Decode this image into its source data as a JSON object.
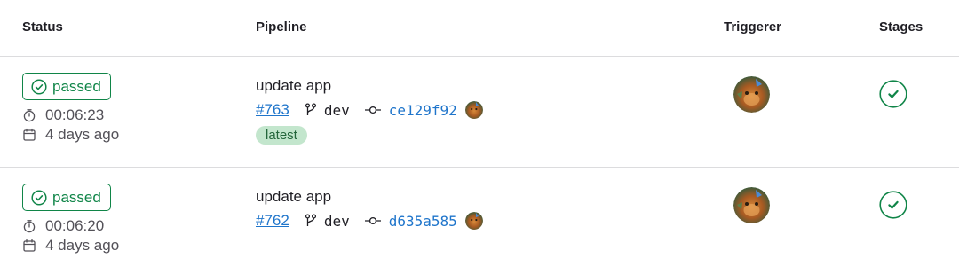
{
  "table": {
    "headers": {
      "status": "Status",
      "pipeline": "Pipeline",
      "triggerer": "Triggerer",
      "stages": "Stages"
    },
    "rows": [
      {
        "status": "passed",
        "duration": "00:06:23",
        "date": "4 days ago",
        "title": "update app",
        "pipeline_id": "#763",
        "branch": "dev",
        "commit": "ce129f92",
        "tag": "latest",
        "stage_status": "success"
      },
      {
        "status": "passed",
        "duration": "00:06:20",
        "date": "4 days ago",
        "title": "update app",
        "pipeline_id": "#762",
        "branch": "dev",
        "commit": "d635a585",
        "stage_status": "success"
      }
    ]
  },
  "icons": {
    "status": "check-circle-icon",
    "duration": "timer-icon",
    "date": "calendar-icon",
    "branch": "branch-icon",
    "commit": "commit-icon",
    "stage": "check-circle-icon"
  },
  "colors": {
    "success": "#108548",
    "link": "#1f75cb",
    "latest_bg": "#c3e6cd",
    "latest_text": "#24663b",
    "muted_text": "#535158",
    "border": "#dcdcde"
  }
}
